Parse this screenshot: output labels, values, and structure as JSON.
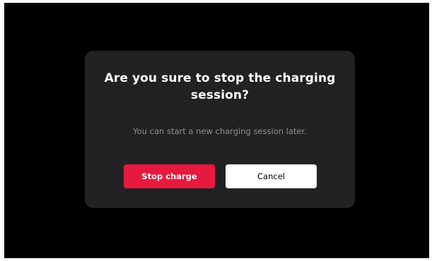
{
  "dialog": {
    "title": "Are you sure to stop the charging session?",
    "message": "You can start a new charging session later.",
    "stop_label": "Stop charge",
    "cancel_label": "Cancel"
  },
  "colors": {
    "background": "#000000",
    "dialog_bg": "#222224",
    "primary": "#e8193f",
    "secondary": "#ffffff",
    "message_text": "#8e8e93"
  }
}
